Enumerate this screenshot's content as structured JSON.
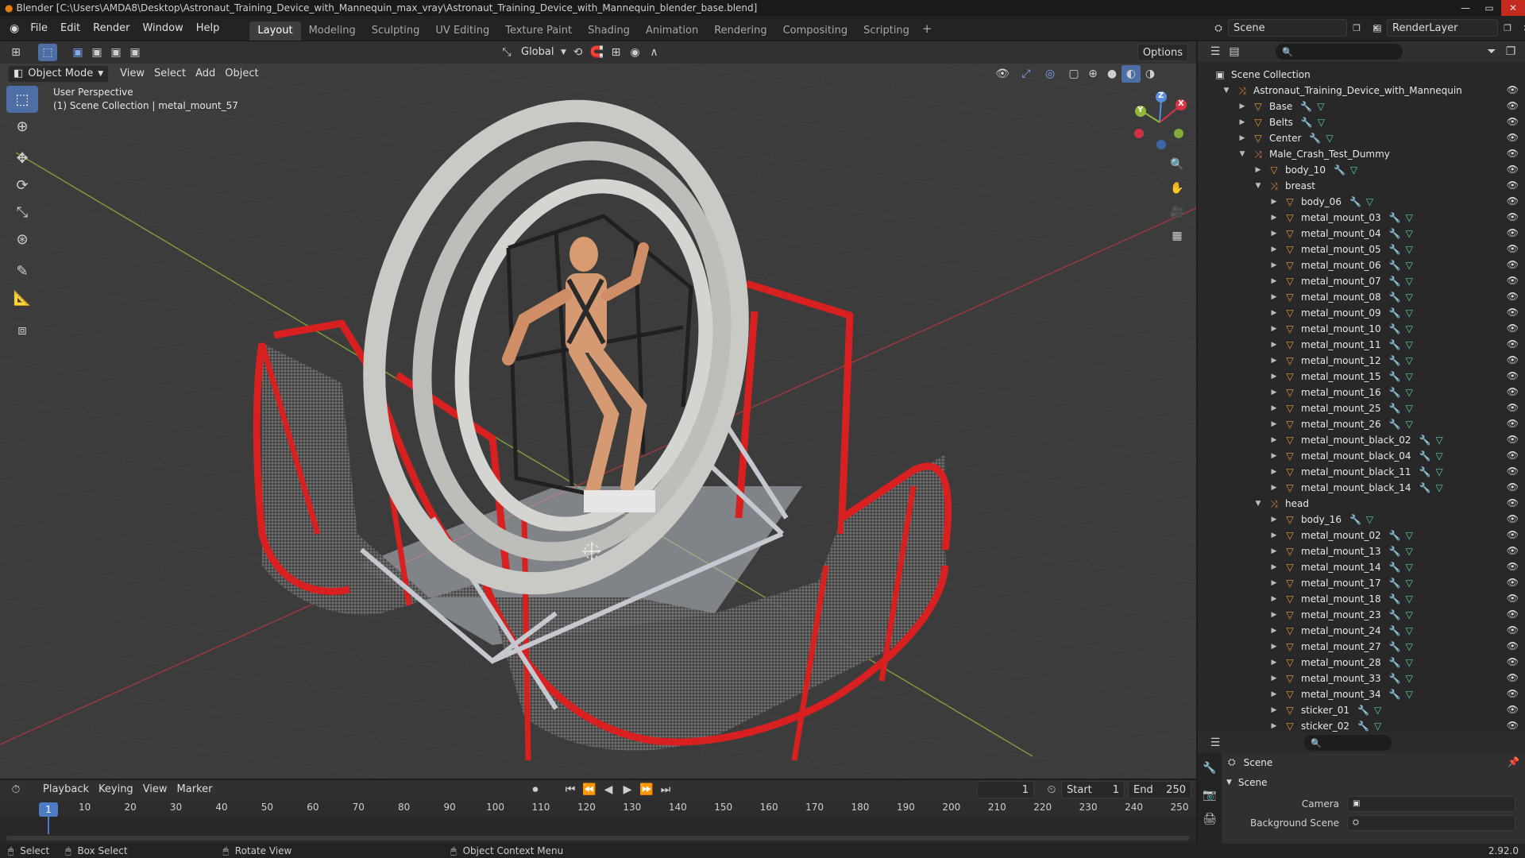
{
  "window": {
    "title": "Blender [C:\\Users\\AMDA8\\Desktop\\Astronaut_Training_Device_with_Mannequin_max_vray\\Astronaut_Training_Device_with_Mannequin_blender_base.blend]"
  },
  "menu": [
    "File",
    "Edit",
    "Render",
    "Window",
    "Help"
  ],
  "workspaces": [
    "Layout",
    "Modeling",
    "Sculpting",
    "UV Editing",
    "Texture Paint",
    "Shading",
    "Animation",
    "Rendering",
    "Compositing",
    "Scripting"
  ],
  "scene": {
    "label": "Scene",
    "render_layer": "RenderLayer"
  },
  "viewport": {
    "header": {
      "mode": "Object Mode",
      "view": "View",
      "select": "Select",
      "add": "Add",
      "object": "Object",
      "transform": "Global",
      "options": "Options"
    },
    "overlay": {
      "line1": "User Perspective",
      "line2": "(1) Scene Collection | metal_mount_57"
    },
    "gizmo": {
      "x": "X",
      "y": "Y",
      "z": "Z"
    }
  },
  "outliner": {
    "root": "Scene Collection",
    "rows": [
      {
        "label": "Astronaut_Training_Device_with_Mannequin",
        "depth": 0,
        "type": "empty",
        "open": true,
        "icons": false
      },
      {
        "label": "Base",
        "depth": 1,
        "type": "mesh",
        "open": false,
        "icons": true
      },
      {
        "label": "Belts",
        "depth": 1,
        "type": "mesh",
        "open": false,
        "icons": true
      },
      {
        "label": "Center",
        "depth": 1,
        "type": "mesh",
        "open": false,
        "icons": true
      },
      {
        "label": "Male_Crash_Test_Dummy",
        "depth": 1,
        "type": "empty",
        "open": true,
        "icons": false
      },
      {
        "label": "body_10",
        "depth": 2,
        "type": "mesh",
        "open": false,
        "icons": true
      },
      {
        "label": "breast",
        "depth": 2,
        "type": "empty",
        "open": true,
        "icons": false
      },
      {
        "label": "body_06",
        "depth": 3,
        "type": "mesh",
        "open": false,
        "icons": true
      },
      {
        "label": "metal_mount_03",
        "depth": 3,
        "type": "mesh",
        "open": false,
        "icons": true
      },
      {
        "label": "metal_mount_04",
        "depth": 3,
        "type": "mesh",
        "open": false,
        "icons": true
      },
      {
        "label": "metal_mount_05",
        "depth": 3,
        "type": "mesh",
        "open": false,
        "icons": true
      },
      {
        "label": "metal_mount_06",
        "depth": 3,
        "type": "mesh",
        "open": false,
        "icons": true
      },
      {
        "label": "metal_mount_07",
        "depth": 3,
        "type": "mesh",
        "open": false,
        "icons": true
      },
      {
        "label": "metal_mount_08",
        "depth": 3,
        "type": "mesh",
        "open": false,
        "icons": true
      },
      {
        "label": "metal_mount_09",
        "depth": 3,
        "type": "mesh",
        "open": false,
        "icons": true
      },
      {
        "label": "metal_mount_10",
        "depth": 3,
        "type": "mesh",
        "open": false,
        "icons": true
      },
      {
        "label": "metal_mount_11",
        "depth": 3,
        "type": "mesh",
        "open": false,
        "icons": true
      },
      {
        "label": "metal_mount_12",
        "depth": 3,
        "type": "mesh",
        "open": false,
        "icons": true
      },
      {
        "label": "metal_mount_15",
        "depth": 3,
        "type": "mesh",
        "open": false,
        "icons": true
      },
      {
        "label": "metal_mount_16",
        "depth": 3,
        "type": "mesh",
        "open": false,
        "icons": true
      },
      {
        "label": "metal_mount_25",
        "depth": 3,
        "type": "mesh",
        "open": false,
        "icons": true
      },
      {
        "label": "metal_mount_26",
        "depth": 3,
        "type": "mesh",
        "open": false,
        "icons": true
      },
      {
        "label": "metal_mount_black_02",
        "depth": 3,
        "type": "mesh",
        "open": false,
        "icons": true
      },
      {
        "label": "metal_mount_black_04",
        "depth": 3,
        "type": "mesh",
        "open": false,
        "icons": true
      },
      {
        "label": "metal_mount_black_11",
        "depth": 3,
        "type": "mesh",
        "open": false,
        "icons": true
      },
      {
        "label": "metal_mount_black_14",
        "depth": 3,
        "type": "mesh",
        "open": false,
        "icons": true
      },
      {
        "label": "head",
        "depth": 2,
        "type": "empty",
        "open": true,
        "icons": false
      },
      {
        "label": "body_16",
        "depth": 3,
        "type": "mesh",
        "open": false,
        "icons": true
      },
      {
        "label": "metal_mount_02",
        "depth": 3,
        "type": "mesh",
        "open": false,
        "icons": true
      },
      {
        "label": "metal_mount_13",
        "depth": 3,
        "type": "mesh",
        "open": false,
        "icons": true
      },
      {
        "label": "metal_mount_14",
        "depth": 3,
        "type": "mesh",
        "open": false,
        "icons": true
      },
      {
        "label": "metal_mount_17",
        "depth": 3,
        "type": "mesh",
        "open": false,
        "icons": true
      },
      {
        "label": "metal_mount_18",
        "depth": 3,
        "type": "mesh",
        "open": false,
        "icons": true
      },
      {
        "label": "metal_mount_23",
        "depth": 3,
        "type": "mesh",
        "open": false,
        "icons": true
      },
      {
        "label": "metal_mount_24",
        "depth": 3,
        "type": "mesh",
        "open": false,
        "icons": true
      },
      {
        "label": "metal_mount_27",
        "depth": 3,
        "type": "mesh",
        "open": false,
        "icons": true
      },
      {
        "label": "metal_mount_28",
        "depth": 3,
        "type": "mesh",
        "open": false,
        "icons": true
      },
      {
        "label": "metal_mount_33",
        "depth": 3,
        "type": "mesh",
        "open": false,
        "icons": true
      },
      {
        "label": "metal_mount_34",
        "depth": 3,
        "type": "mesh",
        "open": false,
        "icons": true
      },
      {
        "label": "sticker_01",
        "depth": 3,
        "type": "mesh",
        "open": false,
        "icons": true
      },
      {
        "label": "sticker_02",
        "depth": 3,
        "type": "mesh",
        "open": false,
        "icons": true
      }
    ]
  },
  "properties": {
    "title": "Scene",
    "section": "Scene",
    "camera_label": "Camera",
    "background_label": "Background Scene"
  },
  "timeline": {
    "playback": "Playback",
    "keying": "Keying",
    "view": "View",
    "marker": "Marker",
    "current_frame": "1",
    "start_label": "Start",
    "start": "1",
    "end_label": "End",
    "end": "250",
    "ticks": [
      "1",
      "10",
      "20",
      "30",
      "40",
      "50",
      "60",
      "70",
      "80",
      "90",
      "100",
      "110",
      "120",
      "130",
      "140",
      "150",
      "160",
      "170",
      "180",
      "190",
      "200",
      "210",
      "220",
      "230",
      "240",
      "250"
    ]
  },
  "status": {
    "select": "Select",
    "box_select": "Box Select",
    "rotate": "Rotate View",
    "context": "Object Context Menu",
    "version": "2.92.0"
  }
}
